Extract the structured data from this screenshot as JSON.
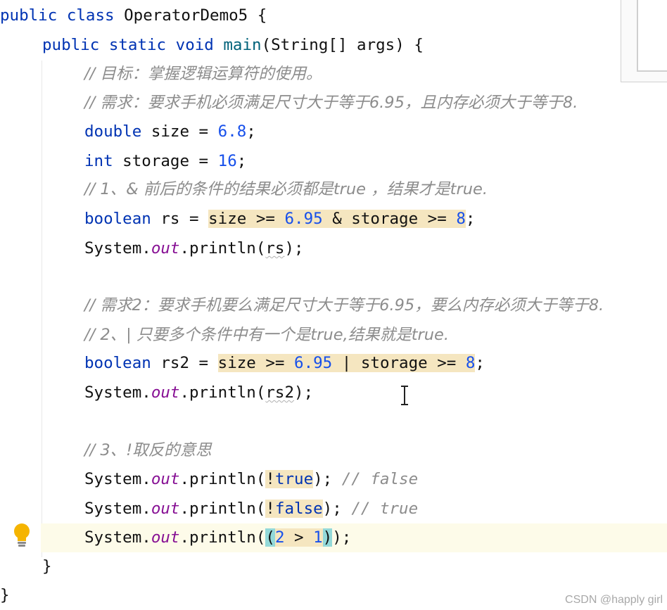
{
  "code": {
    "l1": [
      "public class OperatorDemo5 {"
    ],
    "l2": [
      "public static void",
      " ",
      "main",
      "(String[] args) {"
    ],
    "l3": "// 目标：掌握逻辑运算符的使用。",
    "l4": "// 需求：要求手机必须满足尺寸大于等于6.95，且内存必须大于等于8.",
    "l5": [
      "double",
      " size = ",
      "6.8",
      ";"
    ],
    "l6": [
      "int",
      " storage = ",
      "16",
      ";"
    ],
    "l7": "// 1、& 前后的条件的结果必须都是true ，结果才是true.",
    "l8": [
      "boolean",
      " rs = ",
      "size >= ",
      "6.95",
      " & storage >= ",
      "8",
      ";"
    ],
    "l9": [
      "System.",
      "out",
      ".println(",
      "rs",
      ");"
    ],
    "l11": "// 需求2：要求手机要么满足尺寸大于等于6.95，要么内存必须大于等于8.",
    "l12": "// 2、| 只要多个条件中有一个是true,结果就是true.",
    "l13": [
      "boolean",
      " rs2 = ",
      "size >= ",
      "6.95",
      " | storage >= ",
      "8",
      ";"
    ],
    "l14": [
      "System.",
      "out",
      ".println(",
      "rs2",
      ");"
    ],
    "l16": "// 3、!取反的意思",
    "l17": [
      "System.",
      "out",
      ".println(",
      "!true",
      "); ",
      "// false"
    ],
    "l18": [
      "System.",
      "out",
      ".println(",
      "!false",
      "); ",
      "// true"
    ],
    "l19": [
      "System.",
      "out",
      ".println(",
      "(",
      "2",
      " > ",
      "1",
      ")",
      ");"
    ],
    "l20": "}",
    "l21": "}"
  },
  "watermark": "CSDN @happly girl",
  "icons": {
    "bulb": "lightbulb-icon",
    "cursor": "text-cursor-icon"
  },
  "colors": {
    "keyword": "#0033b3",
    "number": "#1750eb",
    "comment": "#8c8c8c",
    "static_field": "#871094",
    "highlight": "#f5e6c0",
    "bracket_match": "#93d9d9"
  }
}
